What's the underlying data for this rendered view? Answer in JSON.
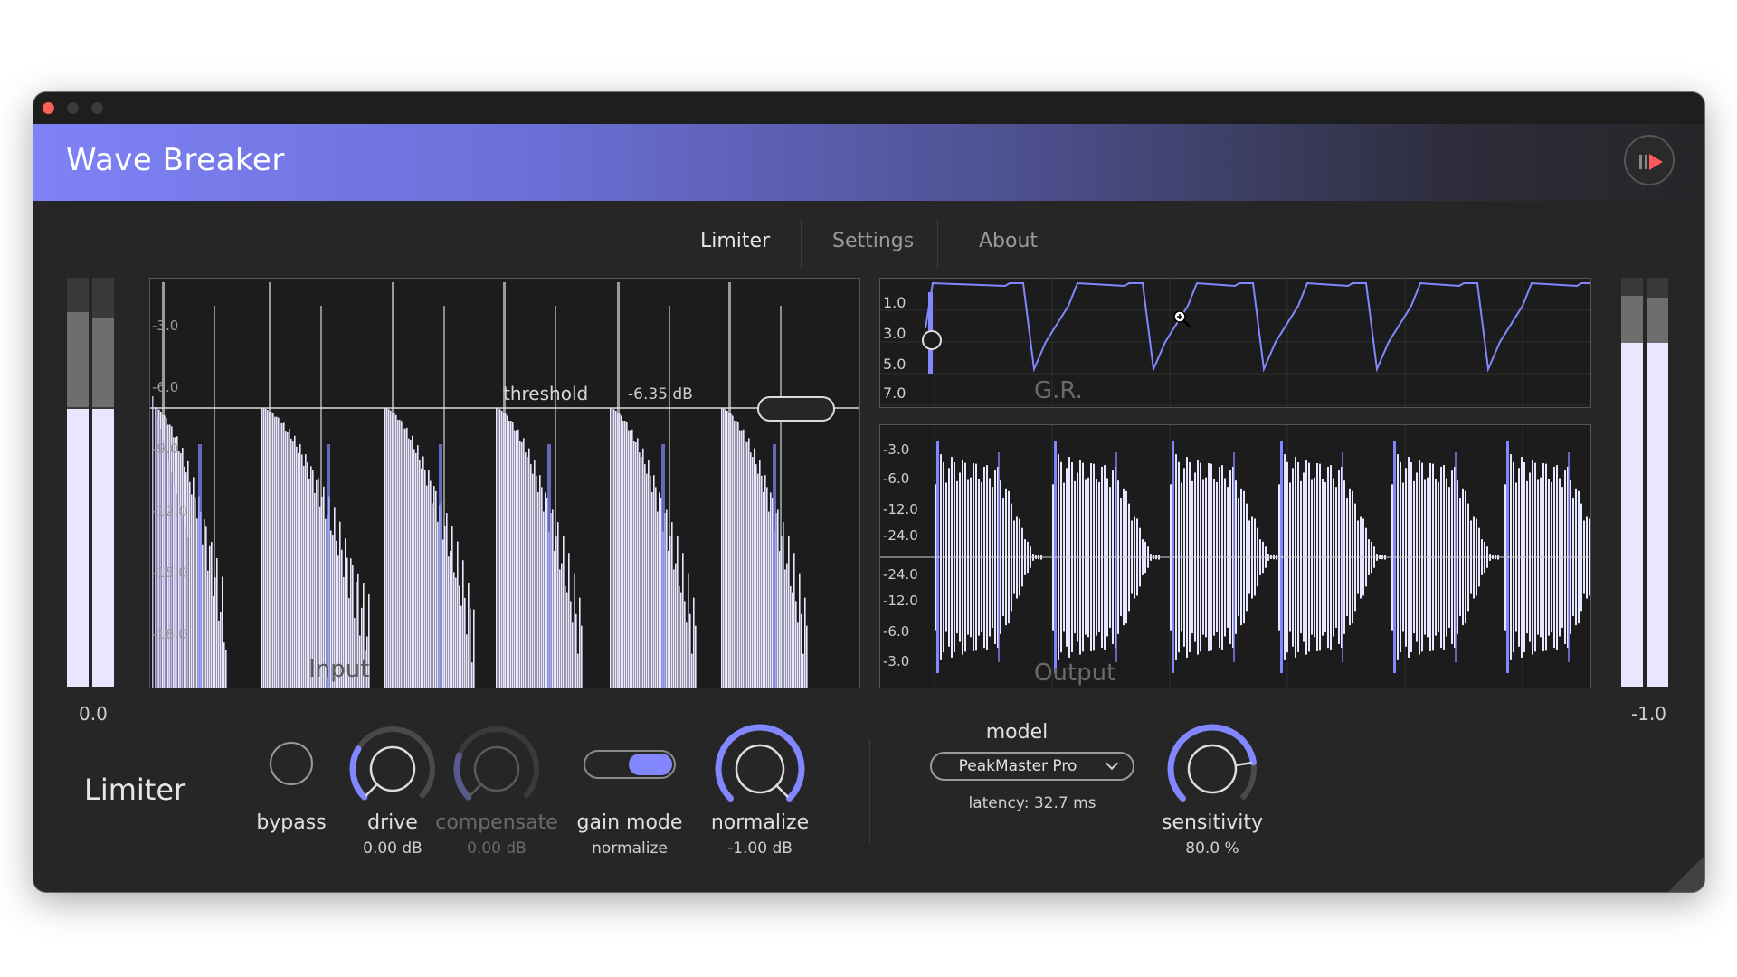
{
  "app": {
    "title": "Wave Breaker"
  },
  "tabs": [
    {
      "label": "Limiter",
      "active": true
    },
    {
      "label": "Settings",
      "active": false
    },
    {
      "label": "About",
      "active": false
    }
  ],
  "input_panel": {
    "title": "Input",
    "db_labels": [
      "-3.0",
      "-6.0",
      "-9.0",
      "-12.0",
      "-15.0",
      "-18.0"
    ],
    "threshold_label": "threshold",
    "threshold_value": "-6.35 dB"
  },
  "gr_panel": {
    "title": "G.R.",
    "labels": [
      "1.0",
      "3.0",
      "5.0",
      "7.0"
    ]
  },
  "output_panel": {
    "title": "Output",
    "labels": [
      "-3.0",
      "-6.0",
      "-12.0",
      "-24.0",
      "-24.0",
      "-12.0",
      "-6.0",
      "-3.0"
    ]
  },
  "meters": {
    "input_value": "0.0",
    "output_value": "-1.0",
    "input_level": 0.68,
    "output_level": 0.84
  },
  "controls": {
    "section_title": "Limiter",
    "bypass": {
      "label": "bypass"
    },
    "drive": {
      "label": "drive",
      "value": "0.00 dB"
    },
    "compensate": {
      "label": "compensate",
      "value": "0.00 dB"
    },
    "gain_mode": {
      "label": "gain mode",
      "value": "normalize"
    },
    "normalize": {
      "label": "normalize",
      "value": "-1.00 dB"
    },
    "model": {
      "label": "model",
      "selected": "PeakMaster Pro"
    },
    "latency": "latency: 32.7 ms",
    "sensitivity": {
      "label": "sensitivity",
      "value": "80.0 %"
    }
  },
  "colors": {
    "accent": "#8387ff",
    "wave": "#e9e6ff",
    "background": "#262626"
  },
  "icons": {
    "logo": "pause-play-icon",
    "cursor": "zoom-in-cursor-icon"
  }
}
